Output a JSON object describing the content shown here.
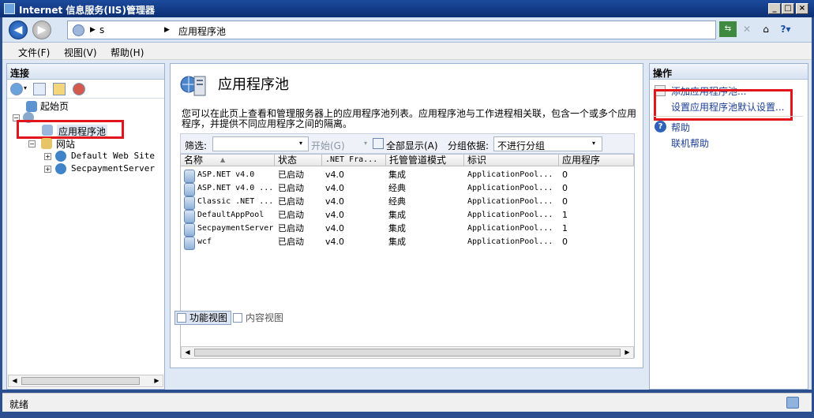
{
  "window": {
    "title": "Internet 信息服务(IIS)管理器"
  },
  "address": {
    "segments": [
      "s",
      "应用程序池"
    ]
  },
  "menu": {
    "items": [
      "文件(F)",
      "视图(V)",
      "帮助(H)"
    ]
  },
  "connections": {
    "title": "连接",
    "tree": {
      "start_page": "起始页",
      "app_pools": "应用程序池",
      "sites": "网站",
      "site1": "Default Web Site",
      "site2": "SecpaymentServer"
    }
  },
  "main": {
    "title": "应用程序池",
    "description": "您可以在此页上查看和管理服务器上的应用程序池列表。应用程序池与工作进程相关联，包含一个或多个应用程序，并提供不同应用程序之间的隔离。",
    "filter": {
      "label": "筛选:",
      "start": "开始(G)",
      "show_all": "全部显示(A)",
      "group_by": "分组依据:",
      "group_value": "不进行分组"
    },
    "columns": [
      "名称",
      "状态",
      ".NET Fra...",
      "托管管道模式",
      "标识",
      "应用程序"
    ],
    "rows": [
      {
        "name": "ASP.NET v4.0",
        "status": "已启动",
        "net": "v4.0",
        "pipeline": "集成",
        "identity": "ApplicationPool...",
        "apps": "0"
      },
      {
        "name": "ASP.NET v4.0 ...",
        "status": "已启动",
        "net": "v4.0",
        "pipeline": "经典",
        "identity": "ApplicationPool...",
        "apps": "0"
      },
      {
        "name": "Classic .NET ...",
        "status": "已启动",
        "net": "v4.0",
        "pipeline": "经典",
        "identity": "ApplicationPool...",
        "apps": "0"
      },
      {
        "name": "DefaultAppPool",
        "status": "已启动",
        "net": "v4.0",
        "pipeline": "集成",
        "identity": "ApplicationPool...",
        "apps": "1"
      },
      {
        "name": "SecpaymentServer",
        "status": "已启动",
        "net": "v4.0",
        "pipeline": "集成",
        "identity": "ApplicationPool...",
        "apps": "1"
      },
      {
        "name": "wcf",
        "status": "已启动",
        "net": "v4.0",
        "pipeline": "集成",
        "identity": "ApplicationPool...",
        "apps": "0"
      }
    ],
    "view_tabs": [
      "功能视图",
      "内容视图"
    ]
  },
  "actions": {
    "title": "操作",
    "add_pool": "添加应用程序池...",
    "set_defaults": "设置应用程序池默认设置...",
    "help": "帮助",
    "online_help": "联机帮助"
  },
  "status": {
    "text": "就绪"
  },
  "colors": {
    "highlight_box": "#e0161b",
    "title_bar": "#0b2f73",
    "link": "#1b3f94"
  }
}
